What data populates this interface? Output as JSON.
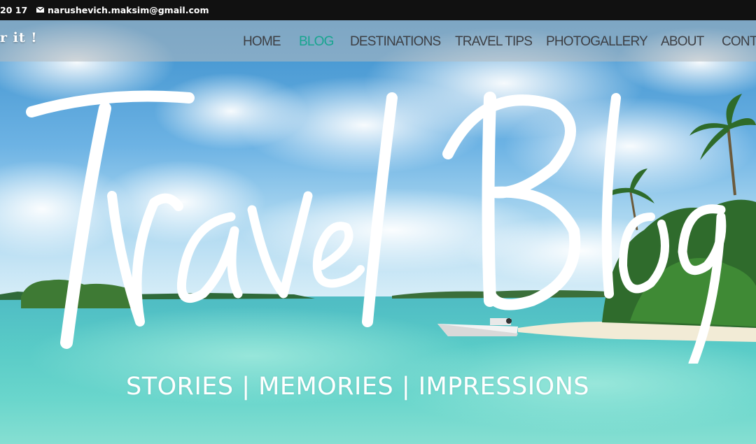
{
  "topbar": {
    "phone": "20 17",
    "email": "narushevich.maksim@gmail.com",
    "email_icon": "envelope-icon"
  },
  "header": {
    "logo_tail": "r it !",
    "nav": [
      {
        "label": "HOME",
        "active": false
      },
      {
        "label": "BLOG",
        "active": true
      },
      {
        "label": "DESTINATIONS",
        "active": false
      },
      {
        "label": "TRAVEL TIPS",
        "active": false
      },
      {
        "label": "PHOTOGALLERY",
        "active": false
      },
      {
        "label": "ABOUT",
        "active": false
      },
      {
        "label": "CONTA",
        "active": false
      }
    ]
  },
  "hero": {
    "title_word_1": "Travel",
    "title_word_2": "Blog",
    "tagline": "STORIES | MEMORIES | IMPRESSIONS"
  },
  "colors": {
    "topbar_bg": "#111111",
    "nav_text": "#3d3f44",
    "nav_active": "#18a58f",
    "sea": "#5cc8c6",
    "sky": "#4a9fd8"
  }
}
